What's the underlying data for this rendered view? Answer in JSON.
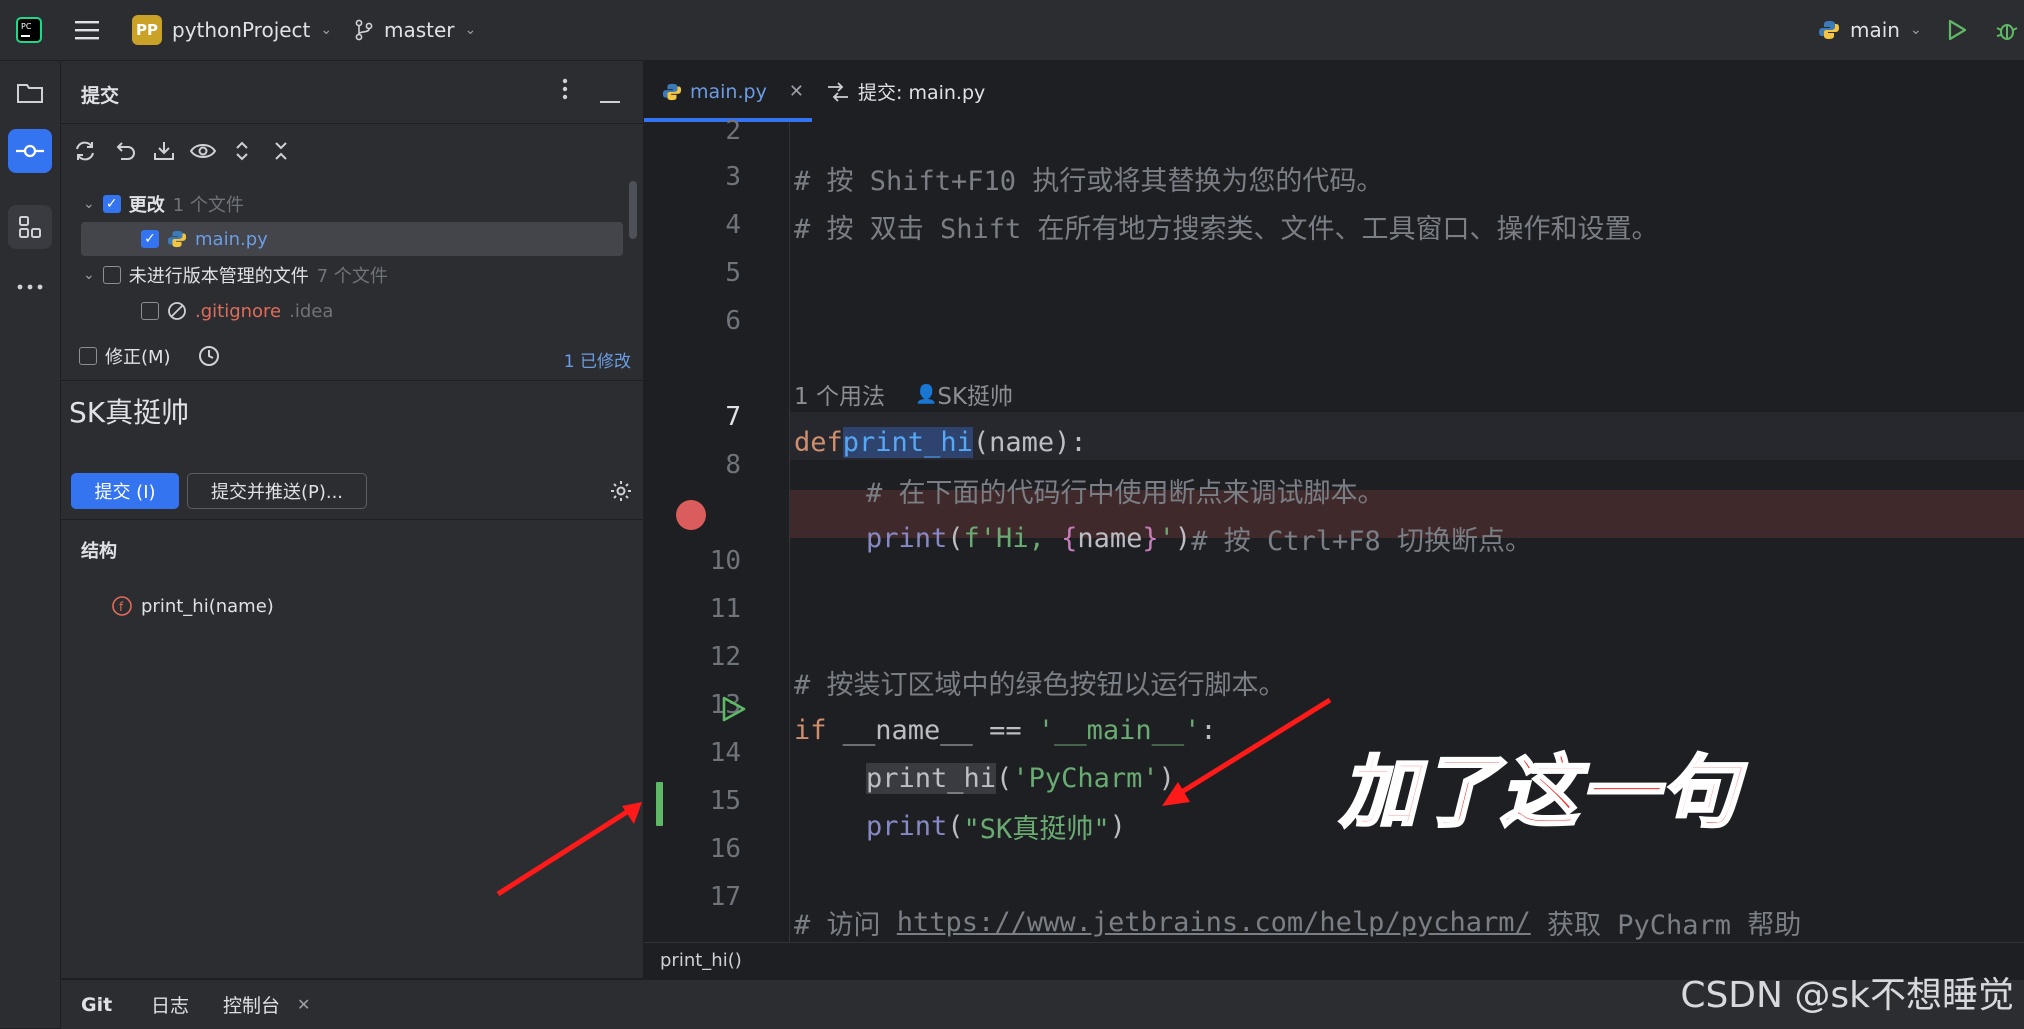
{
  "titlebar": {
    "project_badge": "PP",
    "project_name": "pythonProject",
    "branch": "master",
    "run_config": "main"
  },
  "commit_panel": {
    "title": "提交",
    "changes_label": "更改",
    "changes_count": "1 个文件",
    "changed_file": "main.py",
    "unversioned_label": "未进行版本管理的文件",
    "unversioned_count": "7 个文件",
    "unversioned_file": ".gitignore",
    "unversioned_dir": ".idea",
    "amend_label": "修正(M)",
    "modified_count": "1 已修改",
    "commit_message": "SK真挺帅",
    "commit_button": "提交 (I)",
    "commit_push_button": "提交并推送(P)...",
    "structure_title": "结构",
    "structure_item": "print_hi(name)"
  },
  "editor": {
    "tabs": [
      {
        "label": "main.py"
      },
      {
        "label": "提交: main.py"
      }
    ],
    "line_numbers": [
      "2",
      "3",
      "4",
      "5",
      "6",
      "7",
      "8",
      "",
      "10",
      "11",
      "12",
      "13",
      "14",
      "15",
      "16",
      "17"
    ],
    "usage_hint": "1 个用法",
    "author_hint": "SK挺帅",
    "code": {
      "l3": "# 按 Shift+F10 执行或将其替换为您的代码。",
      "l4": "# 按 双击 Shift 在所有地方搜索类、文件、工具窗口、操作和设置。",
      "l7_def": "def",
      "l7_fn": "print_hi",
      "l7_rest": "(name):",
      "l8": "# 在下面的代码行中使用断点来调试脚本。",
      "l9_print": "print",
      "l9_open": "(",
      "l9_str1": "f'Hi, ",
      "l9_brace1": "{",
      "l9_name": "name",
      "l9_brace2": "}",
      "l9_str2": "'",
      "l9_close": ")",
      "l9_comment": "# 按 Ctrl+F8 切换断点。",
      "l12": "# 按装订区域中的绿色按钮以运行脚本。",
      "l13_if": "if",
      "l13_mid": " __name__ == ",
      "l13_str": "'__main__'",
      "l13_end": ":",
      "l14_fn": "print_hi",
      "l14_open": "(",
      "l14_str": "'PyCharm'",
      "l14_close": ")",
      "l15_print": "print",
      "l15_open": "(",
      "l15_str": "\"SK真挺帅\"",
      "l15_close": ")",
      "l17_pre": "# 访问 ",
      "l17_link": "https://www.jetbrains.com/help/pycharm/",
      "l17_post": " 获取 PyCharm 帮助"
    },
    "breadcrumb": "print_hi()"
  },
  "annotation": {
    "text": "加了这一句",
    "color": "#ff1a1a"
  },
  "bottom_tabs": {
    "git": "Git",
    "log": "日志",
    "console": "控制台"
  },
  "watermark": "CSDN @sk不想睡觉",
  "colors": {
    "accent": "#3574f0",
    "breakpoint": "#db5c5c",
    "run_green": "#5fb865",
    "changed_bar": "#5fb865",
    "breakpoint_line_bg": "#40292b"
  }
}
